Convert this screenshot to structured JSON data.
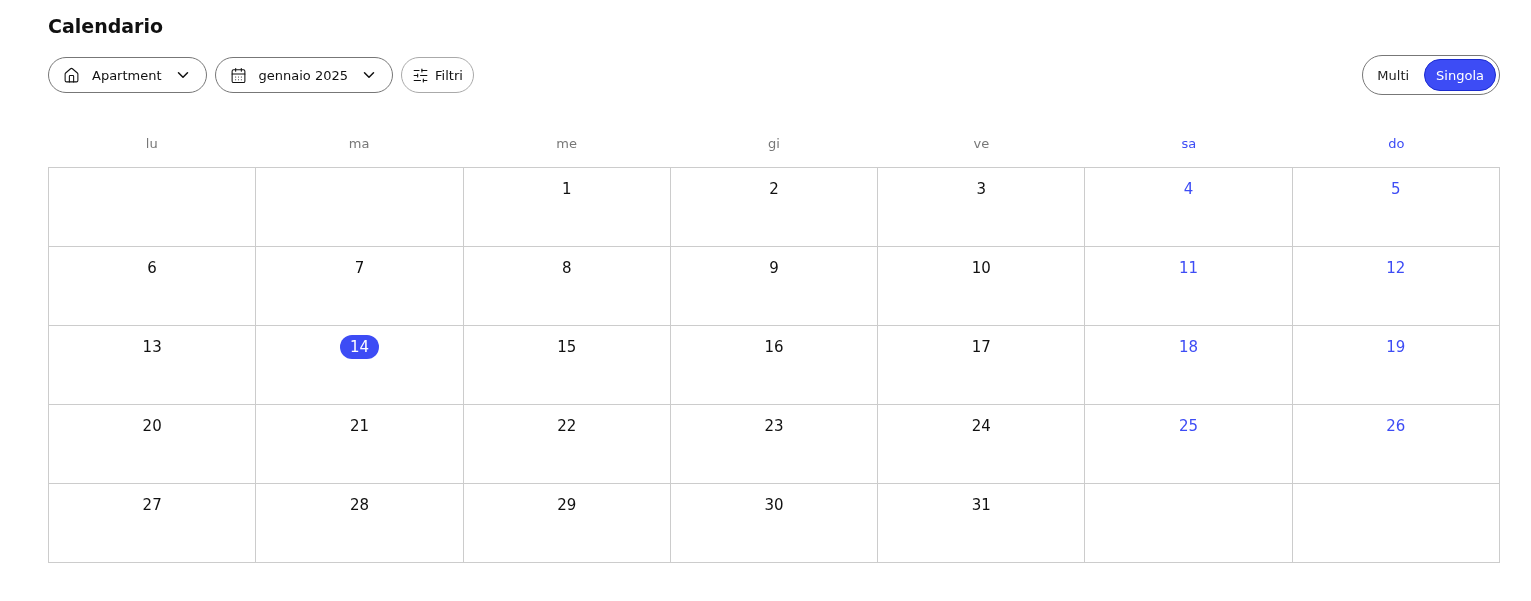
{
  "title": "Calendario",
  "toolbar": {
    "property": {
      "label": "Apartment"
    },
    "month": {
      "label": "gennaio 2025"
    },
    "filters": {
      "label": "Filtri"
    }
  },
  "view_toggle": [
    {
      "label": "Multi",
      "selected": false
    },
    {
      "label": "Singola",
      "selected": true
    }
  ],
  "weekdays": [
    {
      "label": "lu",
      "weekend": false
    },
    {
      "label": "ma",
      "weekend": false
    },
    {
      "label": "me",
      "weekend": false
    },
    {
      "label": "gi",
      "weekend": false
    },
    {
      "label": "ve",
      "weekend": false
    },
    {
      "label": "sa",
      "weekend": true
    },
    {
      "label": "do",
      "weekend": true
    }
  ],
  "weeks": [
    [
      {
        "kind": "blank"
      },
      {
        "kind": "blank"
      },
      {
        "kind": "day",
        "day": "1",
        "today": false
      },
      {
        "kind": "day",
        "day": "2",
        "today": false
      },
      {
        "kind": "day",
        "day": "3",
        "today": false
      },
      {
        "kind": "day",
        "day": "4",
        "today": false
      },
      {
        "kind": "day",
        "day": "5",
        "today": false
      }
    ],
    [
      {
        "kind": "day",
        "day": "6",
        "today": false
      },
      {
        "kind": "day",
        "day": "7",
        "today": false
      },
      {
        "kind": "day",
        "day": "8",
        "today": false
      },
      {
        "kind": "day",
        "day": "9",
        "today": false
      },
      {
        "kind": "day",
        "day": "10",
        "today": false
      },
      {
        "kind": "day",
        "day": "11",
        "today": false
      },
      {
        "kind": "day",
        "day": "12",
        "today": false
      }
    ],
    [
      {
        "kind": "day",
        "day": "13",
        "today": false
      },
      {
        "kind": "day",
        "day": "14",
        "today": true
      },
      {
        "kind": "day",
        "day": "15",
        "today": false
      },
      {
        "kind": "day",
        "day": "16",
        "today": false
      },
      {
        "kind": "day",
        "day": "17",
        "today": false
      },
      {
        "kind": "day",
        "day": "18",
        "today": false
      },
      {
        "kind": "day",
        "day": "19",
        "today": false
      }
    ],
    [
      {
        "kind": "day",
        "day": "20",
        "today": false
      },
      {
        "kind": "day",
        "day": "21",
        "today": false
      },
      {
        "kind": "day",
        "day": "22",
        "today": false
      },
      {
        "kind": "day",
        "day": "23",
        "today": false
      },
      {
        "kind": "day",
        "day": "24",
        "today": false
      },
      {
        "kind": "day",
        "day": "25",
        "today": false
      },
      {
        "kind": "day",
        "day": "26",
        "today": false
      }
    ],
    [
      {
        "kind": "day",
        "day": "27",
        "today": false
      },
      {
        "kind": "day",
        "day": "28",
        "today": false
      },
      {
        "kind": "day",
        "day": "29",
        "today": false
      },
      {
        "kind": "day",
        "day": "30",
        "today": false
      },
      {
        "kind": "day",
        "day": "31",
        "today": false
      },
      {
        "kind": "blank"
      },
      {
        "kind": "blank"
      }
    ]
  ]
}
